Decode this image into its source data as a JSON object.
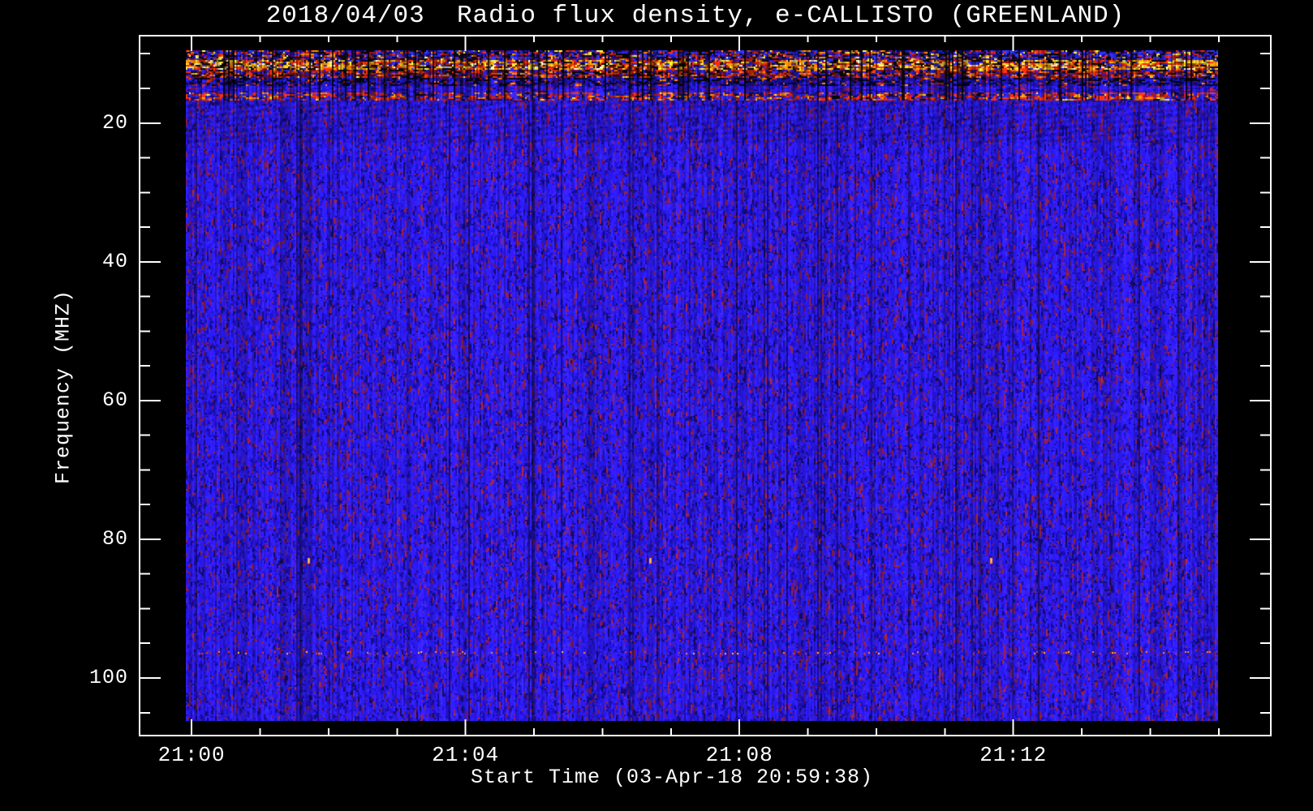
{
  "figure": {
    "background": "#000000",
    "frame_color": "#ffffff",
    "text_color": "#ffffff"
  },
  "chart_data": {
    "type": "heatmap",
    "subtype": "radio_spectrogram",
    "title": "2018/04/03  Radio flux density, e-CALLISTO (GREENLAND)",
    "date": "2018/04/03",
    "station": "GREENLAND",
    "xlabel": "Start Time (03-Apr-18 20:59:38)",
    "ylabel": "Frequency (MHZ)",
    "grid": false,
    "legend": false,
    "x_axis": {
      "major_tick_labels": [
        "21:00",
        "21:04",
        "21:08",
        "21:12"
      ],
      "major_tick_minutes": [
        0,
        4,
        8,
        12
      ],
      "minor_tick_every_min": 1,
      "minor_tick_range_min": [
        1,
        15
      ],
      "axis_range_min": [
        -0.76,
        15.76
      ],
      "data_span_min": [
        -0.05,
        15.0
      ]
    },
    "y_axis": {
      "major_tick_labels": [
        "20",
        "40",
        "60",
        "80",
        "100"
      ],
      "major_tick_mhz": [
        20,
        40,
        60,
        80,
        100
      ],
      "minor_tick_every_mhz": 5,
      "axis_range_mhz": [
        7.4,
        108.3
      ],
      "data_span_mhz": [
        9.5,
        105.9
      ],
      "orientation": "frequency increases downward"
    },
    "background_field": {
      "desc": "dense blue noise field with sparse dark-red and purple speckles",
      "palette": "field"
    },
    "bands": [
      {
        "name": "rfi-speckle",
        "freq_mhz": [
          9.5,
          10.9
        ],
        "palette": "mix"
      },
      {
        "name": "rfi-bright",
        "freq_mhz": [
          10.9,
          12.3
        ],
        "palette": "hot"
      },
      {
        "name": "rfi-red",
        "freq_mhz": [
          12.3,
          13.5
        ],
        "palette": "red"
      },
      {
        "name": "rfi-dark",
        "freq_mhz": [
          13.5,
          14.8
        ],
        "palette": "dark"
      },
      {
        "name": "quiet-blue",
        "freq_mhz": [
          14.8,
          15.6
        ],
        "palette": "field"
      },
      {
        "name": "rfi-redline",
        "freq_mhz": [
          15.6,
          16.8
        ],
        "palette": "redline"
      }
    ],
    "herringbone_zone_mhz": [
      16.8,
      23.0
    ],
    "dotted_line": {
      "freq_mhz": 96.3,
      "colors": [
        "#e03c10",
        "#ff8c1e",
        "#ffc040"
      ],
      "desc": "faint dotted interference line"
    },
    "point_marks": [
      {
        "time_min": 1.7,
        "freq_mhz": 83,
        "color": "#ff9a28"
      },
      {
        "time_min": 6.69,
        "freq_mhz": 83,
        "color": "#ff9a28"
      },
      {
        "time_min": 11.67,
        "freq_mhz": 83,
        "color": "#ff9a28"
      }
    ],
    "palettes": {
      "field": [
        [
          "#2c1af0",
          46
        ],
        [
          "#3424fa",
          12
        ],
        [
          "#2012cd",
          16
        ],
        [
          "#180ca5",
          9
        ],
        [
          "#801c54",
          6
        ],
        [
          "#601478",
          4
        ],
        [
          "#120a69",
          5
        ],
        [
          "#96233c",
          2
        ]
      ],
      "mix": [
        [
          "#2d2dff",
          24
        ],
        [
          "#cd2319",
          14
        ],
        [
          "#0c0c2d",
          14
        ],
        [
          "#190fa5",
          14
        ],
        [
          "#ff7d05",
          6
        ],
        [
          "#f2de41",
          5
        ],
        [
          "#550f7d",
          9
        ],
        [
          "#050505",
          14
        ]
      ],
      "hot": [
        [
          "#ffd42d",
          18
        ],
        [
          "#ff9105",
          16
        ],
        [
          "#ff2d0c",
          18
        ],
        [
          "#fff6b9",
          7
        ],
        [
          "#9b190c",
          10
        ],
        [
          "#080808",
          15
        ],
        [
          "#2d23e1",
          12
        ],
        [
          "#783c0a",
          4
        ]
      ],
      "red": [
        [
          "#de2d0c",
          22
        ],
        [
          "#7d1208",
          14
        ],
        [
          "#ff7d19",
          9
        ],
        [
          "#080808",
          19
        ],
        [
          "#2319b9",
          22
        ],
        [
          "#550a41",
          9
        ],
        [
          "#ffc83c",
          2
        ],
        [
          "#3228f0",
          3
        ]
      ],
      "dark": [
        [
          "#16109b",
          28
        ],
        [
          "#040416",
          24
        ],
        [
          "#261ce8",
          24
        ],
        [
          "#ff7d0c",
          3
        ],
        [
          "#b9230c",
          6
        ],
        [
          "#410c5f",
          10
        ],
        [
          "#0a0a3c",
          5
        ]
      ],
      "redline": [
        [
          "#e82d12",
          26
        ],
        [
          "#ff870c",
          10
        ],
        [
          "#9b192d",
          13
        ],
        [
          "#2d23e1",
          30
        ],
        [
          "#190f7d",
          15
        ],
        [
          "#ffd232",
          2
        ],
        [
          "#080808",
          4
        ]
      ]
    }
  }
}
